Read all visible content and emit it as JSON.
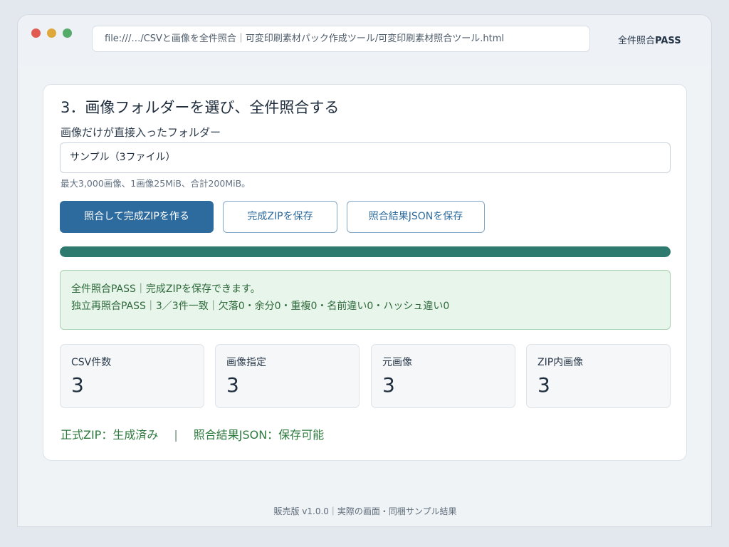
{
  "browser": {
    "address": "file:///…/CSVと画像を全件照合｜可変印刷素材パック作成ツール/可変印刷素材照合ツール.html",
    "tag_prefix": "全件照合",
    "tag_bold": "PASS"
  },
  "section": {
    "heading": "3．画像フォルダーを選び、全件照合する",
    "field_label": "画像だけが直接入ったフォルダー",
    "folder_value": "サンプル（3ファイル）",
    "hint": "最大3,000画像、1画像25MiB、合計200MiB。"
  },
  "buttons": {
    "verify": "照合して完成ZIPを作る",
    "save_zip": "完成ZIPを保存",
    "save_json": "照合結果JSONを保存"
  },
  "progress": {
    "percent": 100,
    "color": "#2e7a6e"
  },
  "status": {
    "line1": "全件照合PASS｜完成ZIPを保存できます。",
    "line2": "独立再照合PASS｜3／3件一致｜欠落0・余分0・重複0・名前違い0・ハッシュ違い0"
  },
  "stats": [
    {
      "label": "CSV件数",
      "value": "3"
    },
    {
      "label": "画像指定",
      "value": "3"
    },
    {
      "label": "元画像",
      "value": "3"
    },
    {
      "label": "ZIP内画像",
      "value": "3"
    }
  ],
  "results": {
    "zip_status": "正式ZIP：生成済み",
    "separator": "|",
    "json_status": "照合結果JSON：保存可能"
  },
  "footer": "販売版 v1.0.0｜実際の画面・同梱サンプル結果",
  "colors": {
    "primary": "#2d6b9e",
    "success_bg": "#e7f5ea",
    "success_text": "#2f6a3c"
  }
}
